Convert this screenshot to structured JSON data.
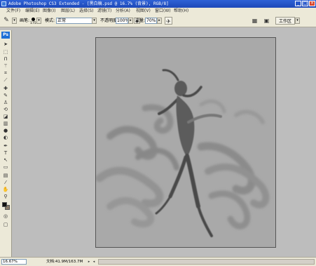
{
  "window": {
    "title": "Adobe Photoshop CS3 Extended - [黑白稿.psd @ 16.7% (背景), RGB/8]",
    "buttons": {
      "minimize": "_",
      "maximize": "□",
      "close": "×"
    }
  },
  "menu": [
    "文件(F)",
    "编辑(E)",
    "图像(I)",
    "图层(L)",
    "选择(S)",
    "滤镜(T)",
    "分析(A)",
    "视图(V)",
    "窗口(W)",
    "帮助(H)"
  ],
  "options": {
    "brush_label": "画笔:",
    "brush_size": "175",
    "mode_label": "模式:",
    "mode_value": "正常",
    "opacity_label": "不透明度:",
    "opacity_value": "100%",
    "flow_label": "流量:",
    "flow_value": "70%",
    "workspace_label": "工作区"
  },
  "toolbox": {
    "logo": "Ps",
    "tools": [
      "move-tool",
      "marquee-tool",
      "lasso-tool",
      "magic-wand-tool",
      "crop-tool",
      "slice-tool",
      "healing-brush-tool",
      "brush-tool",
      "clone-stamp-tool",
      "history-brush-tool",
      "eraser-tool",
      "gradient-tool",
      "blur-tool",
      "dodge-tool",
      "pen-tool",
      "type-tool",
      "path-selection-tool",
      "shape-tool",
      "notes-tool",
      "eyedropper-tool",
      "hand-tool",
      "zoom-tool"
    ],
    "foreground_color": "#111111",
    "background_color": "#8a7b68"
  },
  "status": {
    "zoom": "16.67%",
    "doc_info": "文档:41.9M/163.7M"
  },
  "colors": {
    "title_bar": "#2456c8",
    "chrome": "#ece9d8",
    "workspace": "#bdbdbd",
    "canvas": "#a9a9a9"
  }
}
